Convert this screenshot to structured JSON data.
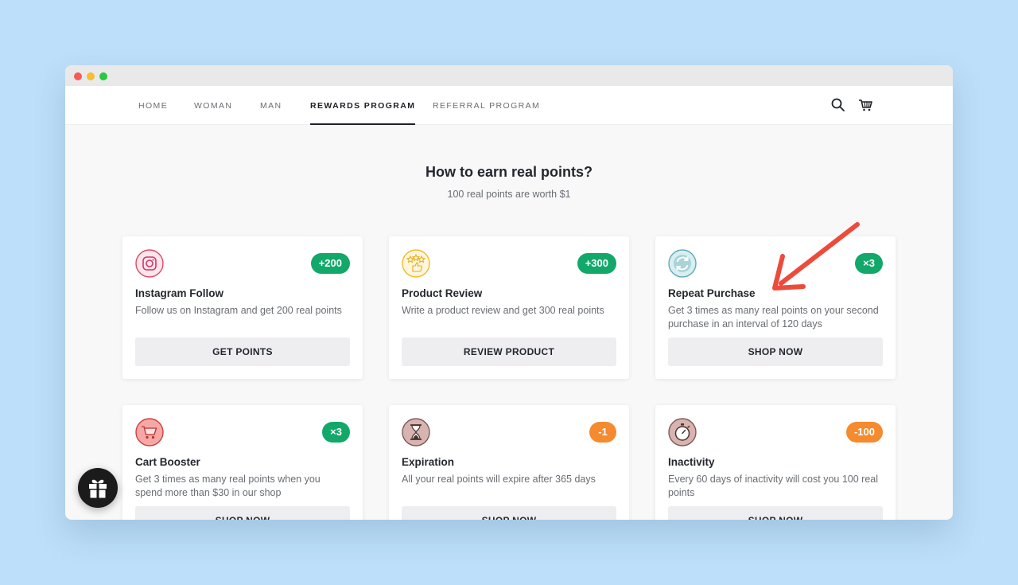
{
  "nav": {
    "items": [
      {
        "label": "HOME",
        "active": false
      },
      {
        "label": "WOMAN",
        "active": false
      },
      {
        "label": "MAN",
        "active": false
      },
      {
        "label": "REWARDS PROGRAM",
        "active": true
      },
      {
        "label": "REFERRAL PROGRAM",
        "active": false
      }
    ],
    "icons": [
      "search-icon",
      "cart-icon"
    ]
  },
  "page": {
    "title": "How to earn real points?",
    "subtitle": "100 real points are worth $1"
  },
  "cards": [
    {
      "icon": "instagram-icon",
      "badge": "+200",
      "badge_color": "#12a86a",
      "title": "Instagram Follow",
      "desc": "Follow us on Instagram and get 200 real points",
      "button": "GET POINTS"
    },
    {
      "icon": "star-review-icon",
      "badge": "+300",
      "badge_color": "#12a86a",
      "title": "Product Review",
      "desc": "Write a product review and get 300 real points",
      "button": "REVIEW PRODUCT"
    },
    {
      "icon": "repeat-icon",
      "badge": "×3",
      "badge_color": "#12a86a",
      "title": "Repeat Purchase",
      "desc": "Get 3 times as many real points on your second purchase in an interval of 120 days",
      "button": "SHOP NOW"
    },
    {
      "icon": "cart-booster-icon",
      "badge": "×3",
      "badge_color": "#12a86a",
      "title": "Cart Booster",
      "desc": "Get 3 times as many real points when you spend more than $30 in our shop",
      "button": "SHOP NOW"
    },
    {
      "icon": "hourglass-icon",
      "badge": "-1",
      "badge_color": "#f58a2f",
      "title": "Expiration",
      "desc": "All your real points will expire after 365 days",
      "button": "SHOP NOW"
    },
    {
      "icon": "stopwatch-icon",
      "badge": "-100",
      "badge_color": "#f58a2f",
      "title": "Inactivity",
      "desc": "Every 60 days of inactivity will cost you 100 real points",
      "button": "SHOP NOW"
    }
  ],
  "colors": {
    "background": "#bddff9",
    "accent_green": "#12a86a",
    "accent_orange": "#f58a2f",
    "annotation_arrow": "#ec4b3c"
  }
}
